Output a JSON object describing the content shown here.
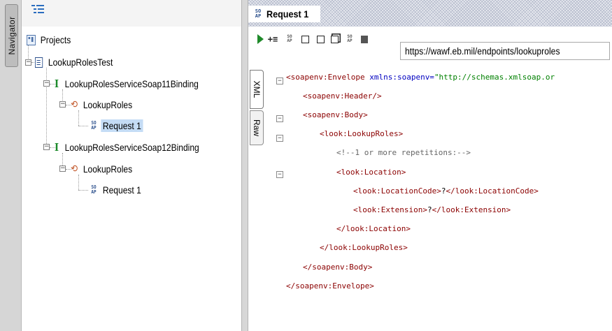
{
  "navigator": {
    "tab_label": "Navigator"
  },
  "tree": {
    "root": "Projects",
    "project": "LookupRolesTest",
    "bindings": [
      {
        "name": "LookupRolesServiceSoap11Binding",
        "operation": "LookupRoles",
        "request": "Request 1",
        "selected": true
      },
      {
        "name": "LookupRolesServiceSoap12Binding",
        "operation": "LookupRoles",
        "request": "Request 1",
        "selected": false
      }
    ]
  },
  "editor": {
    "title": "Request 1",
    "soap_badge": "SOAP",
    "endpoint": "https://wawf.eb.mil/endpoints/lookuproles",
    "side_tabs": [
      "XML",
      "Raw"
    ],
    "code_lines": [
      {
        "indent": 0,
        "parts": [
          [
            "tag",
            "<soapenv:Envelope "
          ],
          [
            "attr",
            "xmlns:soapenv="
          ],
          [
            "val",
            "\"http://schemas.xmlsoap.or"
          ]
        ]
      },
      {
        "indent": 1,
        "parts": [
          [
            "tag",
            "<soapenv:Header/>"
          ]
        ]
      },
      {
        "indent": 1,
        "parts": [
          [
            "tag",
            "<soapenv:Body>"
          ]
        ]
      },
      {
        "indent": 2,
        "parts": [
          [
            "tag",
            "<look:LookupRoles>"
          ]
        ]
      },
      {
        "indent": 3,
        "parts": [
          [
            "cmt",
            "<!--1 or more repetitions:-->"
          ]
        ]
      },
      {
        "indent": 3,
        "parts": [
          [
            "tag",
            "<look:Location>"
          ]
        ]
      },
      {
        "indent": 4,
        "parts": [
          [
            "tag",
            "<look:LocationCode>"
          ],
          [
            "txt",
            "?"
          ],
          [
            "tag",
            "</look:LocationCode>"
          ]
        ]
      },
      {
        "indent": 4,
        "parts": [
          [
            "tag",
            "<look:Extension>"
          ],
          [
            "txt",
            "?"
          ],
          [
            "tag",
            "</look:Extension>"
          ]
        ]
      },
      {
        "indent": 3,
        "parts": [
          [
            "tag",
            "</look:Location>"
          ]
        ]
      },
      {
        "indent": 2,
        "parts": [
          [
            "tag",
            "</look:LookupRoles>"
          ]
        ]
      },
      {
        "indent": 1,
        "parts": [
          [
            "tag",
            "</soapenv:Body>"
          ]
        ]
      },
      {
        "indent": 0,
        "parts": [
          [
            "tag",
            "</soapenv:Envelope>"
          ]
        ]
      }
    ]
  },
  "colors": {
    "selection": "#c4dcf5",
    "tag": "#8b0000",
    "attribute": "#0000c0",
    "value": "#008000",
    "run": "#1f8a2a"
  }
}
